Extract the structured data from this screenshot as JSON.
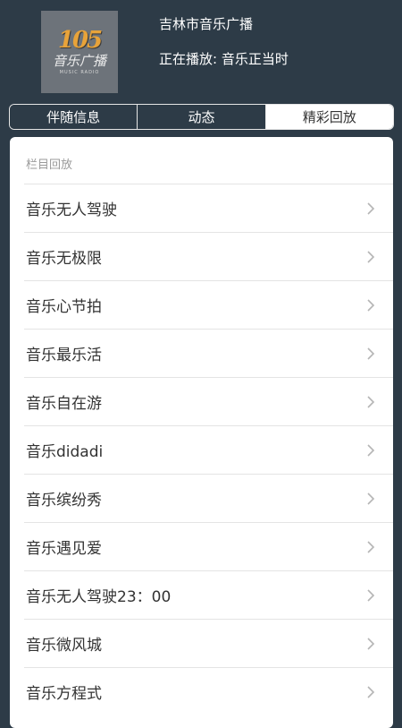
{
  "header": {
    "logo": {
      "mark": "105",
      "name": "音乐广播",
      "tiny": "MUSIC RADIO"
    },
    "station_title": "吉林市音乐广播",
    "now_playing": "正在播放: 音乐正当时"
  },
  "tabs": [
    {
      "label": "伴随信息",
      "active": false
    },
    {
      "label": "动态",
      "active": false
    },
    {
      "label": "精彩回放",
      "active": true
    }
  ],
  "section_label": "栏目回放",
  "programs": [
    {
      "label": "音乐无人驾驶"
    },
    {
      "label": "音乐无极限"
    },
    {
      "label": "音乐心节拍"
    },
    {
      "label": "音乐最乐活"
    },
    {
      "label": "音乐自在游"
    },
    {
      "label": "音乐didadi"
    },
    {
      "label": "音乐缤纷秀"
    },
    {
      "label": "音乐遇见爱"
    },
    {
      "label": "音乐无人驾驶23：00"
    },
    {
      "label": "音乐微风城"
    },
    {
      "label": "音乐方程式"
    }
  ],
  "icons": {
    "chevron": "chevron-right-icon"
  },
  "colors": {
    "header_bg": "#2d3b47",
    "panel_bg": "#ffffff",
    "divider": "#e4e4e4",
    "text": "#333333"
  }
}
